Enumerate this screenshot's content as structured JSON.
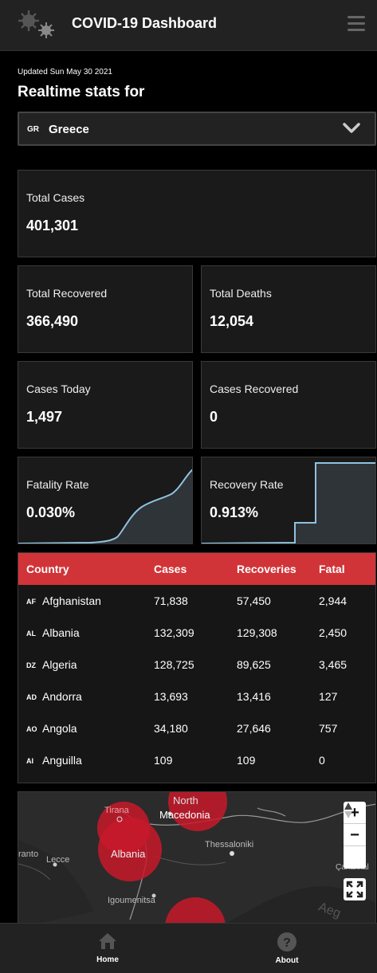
{
  "header": {
    "title": "COVID-19 Dashboard",
    "logo_icon": "virus-icon",
    "menu_icon": "hamburger-icon"
  },
  "stats": {
    "updated": "Updated Sun May 30 2021",
    "heading": "Realtime stats for",
    "country_code": "GR",
    "country_name": "Greece",
    "total_cases_label": "Total Cases",
    "total_cases": "401,301",
    "total_recovered_label": "Total Recovered",
    "total_recovered": "366,490",
    "total_deaths_label": "Total Deaths",
    "total_deaths": "12,054",
    "cases_today_label": "Cases Today",
    "cases_today": "1,497",
    "cases_recovered_label": "Cases Recovered",
    "cases_recovered": "0",
    "fatality_label": "Fatality Rate",
    "fatality_rate": "0.030%",
    "recovery_label": "Recovery Rate",
    "recovery_rate": "0.913%"
  },
  "table": {
    "headers": [
      "Country",
      "Cases",
      "Recoveries",
      "Fatal"
    ],
    "rows": [
      {
        "code": "AF",
        "name": "Afghanistan",
        "cases": "71,838",
        "recoveries": "57,450",
        "fatal": "2,944"
      },
      {
        "code": "AL",
        "name": "Albania",
        "cases": "132,309",
        "recoveries": "129,308",
        "fatal": "2,450"
      },
      {
        "code": "DZ",
        "name": "Algeria",
        "cases": "128,725",
        "recoveries": "89,625",
        "fatal": "3,465"
      },
      {
        "code": "AD",
        "name": "Andorra",
        "cases": "13,693",
        "recoveries": "13,416",
        "fatal": "127"
      },
      {
        "code": "AO",
        "name": "Angola",
        "cases": "34,180",
        "recoveries": "27,646",
        "fatal": "757"
      },
      {
        "code": "AI",
        "name": "Anguilla",
        "cases": "109",
        "recoveries": "109",
        "fatal": "0"
      }
    ]
  },
  "map": {
    "labels": {
      "north": "North",
      "macedonia": "Macedonia",
      "tirana": "Tirana",
      "albania": "Albania",
      "thessaloniki": "Thessaloniki",
      "ranto": "ranto",
      "lecce": "Lecce",
      "igoumenitsa": "Igoumenitsa",
      "aeg": "Aeg",
      "canakkale": "Çanakkal"
    },
    "zoom_in": "+",
    "zoom_out": "−",
    "bubble_color": "#c8192a"
  },
  "nav": {
    "home": "Home",
    "about": "About"
  },
  "colors": {
    "accent": "#d13438",
    "background": "#000000",
    "card": "#1a1a1a"
  }
}
